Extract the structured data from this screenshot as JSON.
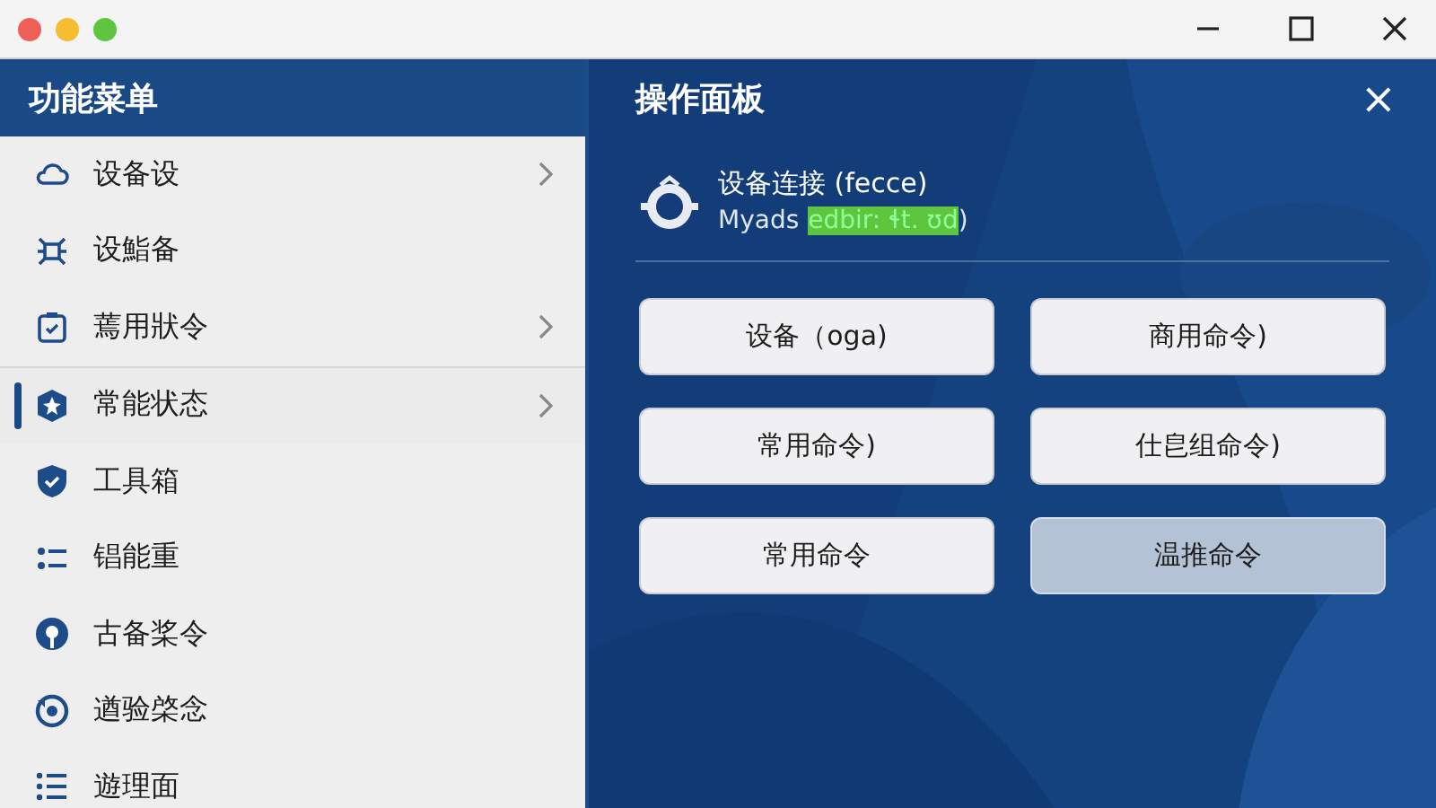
{
  "sidebar": {
    "title": "功能菜单",
    "items": [
      {
        "label": "设备设",
        "kind": "cloud",
        "chevron": true,
        "selected": false
      },
      {
        "label": "设鮨备",
        "kind": "bug",
        "chevron": false,
        "selected": false
      },
      {
        "label": "蔫用狀令",
        "kind": "clipboard",
        "chevron": true,
        "selected": false
      },
      {
        "label": "常能状态",
        "kind": "cube",
        "chevron": true,
        "selected": true
      },
      {
        "label": "工具箱",
        "kind": "shield",
        "chevron": false,
        "selected": false
      },
      {
        "label": "锠能重",
        "kind": "dots",
        "chevron": false,
        "selected": false
      },
      {
        "label": "古备桨令",
        "kind": "pin",
        "chevron": false,
        "selected": false
      },
      {
        "label": "遒验棨念",
        "kind": "refresh",
        "chevron": false,
        "selected": false
      },
      {
        "label": "遊理面",
        "kind": "list",
        "chevron": false,
        "selected": false
      }
    ]
  },
  "panel": {
    "title": "操作面板",
    "close": "×",
    "connection": {
      "title": "设备连接 (fecce)",
      "label": "Myads",
      "value": "edbir: ɬt. ʊd",
      "suffix": ")"
    },
    "buttons": [
      {
        "label": "设备（oga)",
        "selected": false
      },
      {
        "label": "商用命令)",
        "selected": false
      },
      {
        "label": "常用命令)",
        "selected": false
      },
      {
        "label": "仕皀组命令)",
        "selected": false
      },
      {
        "label": "常用命令",
        "selected": false
      },
      {
        "label": "温推命令",
        "selected": true
      }
    ]
  }
}
